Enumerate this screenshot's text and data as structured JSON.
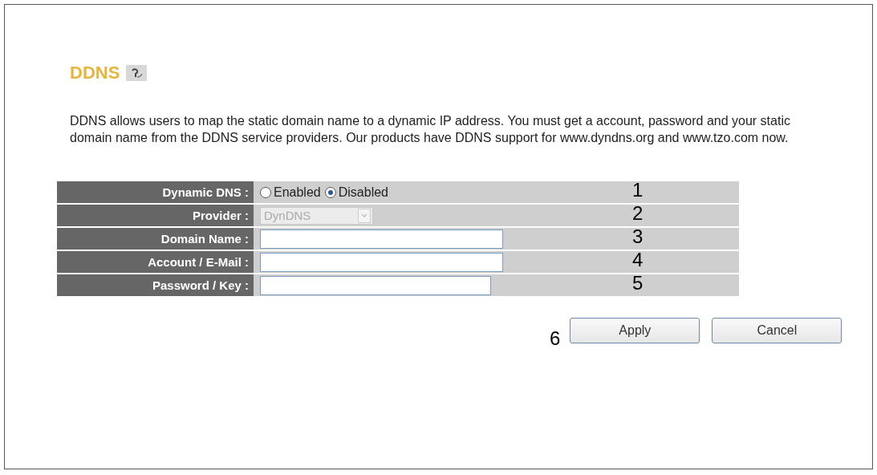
{
  "title": "DDNS",
  "description": "DDNS allows users to map the static domain name to a dynamic IP address. You must get a account, password and your static domain name from the DDNS service providers. Our products have DDNS support for www.dyndns.org and www.tzo.com now.",
  "rows": [
    {
      "kind": "radio",
      "label": "Dynamic DNS :",
      "callout": "1",
      "options": [
        {
          "label": "Enabled",
          "selected": false
        },
        {
          "label": "Disabled",
          "selected": true
        }
      ]
    },
    {
      "kind": "select",
      "label": "Provider :",
      "callout": "2",
      "value": "DynDNS",
      "disabled": true
    },
    {
      "kind": "text",
      "label": "Domain Name :",
      "callout": "3"
    },
    {
      "kind": "text",
      "label": "Account / E-Mail :",
      "callout": "4"
    },
    {
      "kind": "text",
      "label": "Password / Key :",
      "callout": "5"
    }
  ],
  "actions_callout": "6",
  "buttons": [
    "Apply",
    "Cancel"
  ]
}
